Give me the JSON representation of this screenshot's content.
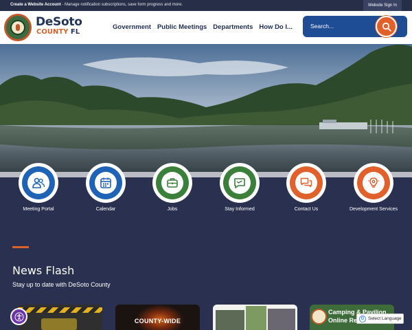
{
  "topbar": {
    "create_link": "Create a Website Account",
    "create_desc": " - Manage notification subscriptions, save form progress and more.",
    "signin": "Website Sign In"
  },
  "header": {
    "logo_line1": "DeSoto",
    "logo_line2a": "COUNTY ",
    "logo_line2b": "FL",
    "nav": [
      "Government",
      "Public Meetings",
      "Departments",
      "How Do I..."
    ],
    "search_placeholder": "Search..."
  },
  "quick_links": [
    {
      "label": "Meeting Portal",
      "icon": "people-icon",
      "color": "blue"
    },
    {
      "label": "Calendar",
      "icon": "calendar-icon",
      "color": "blue"
    },
    {
      "label": "Jobs",
      "icon": "briefcase-icon",
      "color": "green"
    },
    {
      "label": "Stay Informed",
      "icon": "message-icon",
      "color": "green"
    },
    {
      "label": "Contact Us",
      "icon": "chat-bubbles-icon",
      "color": "orange"
    },
    {
      "label": "Development Services",
      "icon": "lightbulb-gear-icon",
      "color": "orange"
    }
  ],
  "news": {
    "title": "News Flash",
    "subtitle": "Stay up to date with DeSoto County",
    "cards": [
      {
        "text": ""
      },
      {
        "text": "COUNTY-WIDE"
      },
      {
        "text": ""
      },
      {
        "line1": "Camping & Pavilion",
        "line2": "Online Re..."
      }
    ]
  },
  "translate": {
    "label": "Select Language"
  },
  "colors": {
    "navy": "#2a3150",
    "blue": "#1f63b6",
    "green": "#3a7f3a",
    "orange": "#e0612b"
  }
}
